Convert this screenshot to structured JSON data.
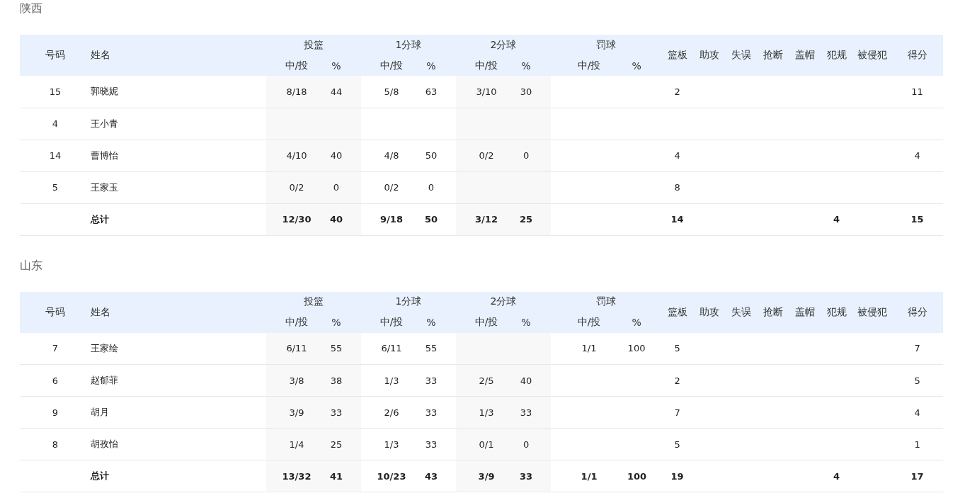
{
  "teams": [
    {
      "name": "陕西",
      "header": {
        "number": "号码",
        "name": "姓名",
        "groups": [
          {
            "label": "投篮",
            "made": "中/投",
            "pct": "%"
          },
          {
            "label": "1分球",
            "made": "中/投",
            "pct": "%"
          },
          {
            "label": "2分球",
            "made": "中/投",
            "pct": "%"
          },
          {
            "label": "罚球",
            "made": "中/投",
            "pct": "%"
          }
        ],
        "stats": [
          "篮板",
          "助攻",
          "失误",
          "抢断",
          "盖帽",
          "犯规",
          "被侵犯",
          "得分"
        ]
      },
      "rows": [
        {
          "kind": "player",
          "number": "15",
          "name": "郭晓妮",
          "field_goals": {
            "made": "8/18",
            "pct": "44"
          },
          "one_pointers": {
            "made": "5/8",
            "pct": "63"
          },
          "two_pointers": {
            "made": "3/10",
            "pct": "30"
          },
          "rebounds": "2",
          "points": "11"
        },
        {
          "kind": "player",
          "number": "4",
          "name": "王小青"
        },
        {
          "kind": "player",
          "number": "14",
          "name": "曹博怡",
          "field_goals": {
            "made": "4/10",
            "pct": "40"
          },
          "one_pointers": {
            "made": "4/8",
            "pct": "50"
          },
          "two_pointers": {
            "made": "0/2",
            "pct": "0"
          },
          "rebounds": "4",
          "points": "4"
        },
        {
          "kind": "player",
          "number": "5",
          "name": "王家玉",
          "field_goals": {
            "made": "0/2",
            "pct": "0"
          },
          "one_pointers": {
            "made": "0/2",
            "pct": "0"
          },
          "rebounds": "8"
        },
        {
          "kind": "total",
          "name": "总计",
          "field_goals": {
            "made": "12/30",
            "pct": "40"
          },
          "one_pointers": {
            "made": "9/18",
            "pct": "50"
          },
          "two_pointers": {
            "made": "3/12",
            "pct": "25"
          },
          "rebounds": "14",
          "fouls": "4",
          "points": "15"
        }
      ]
    },
    {
      "name": "山东",
      "header": {
        "number": "号码",
        "name": "姓名",
        "groups": [
          {
            "label": "投篮",
            "made": "中/投",
            "pct": "%"
          },
          {
            "label": "1分球",
            "made": "中/投",
            "pct": "%"
          },
          {
            "label": "2分球",
            "made": "中/投",
            "pct": "%"
          },
          {
            "label": "罚球",
            "made": "中/投",
            "pct": "%"
          }
        ],
        "stats": [
          "篮板",
          "助攻",
          "失误",
          "抢断",
          "盖帽",
          "犯规",
          "被侵犯",
          "得分"
        ]
      },
      "rows": [
        {
          "kind": "player",
          "number": "7",
          "name": "王家绘",
          "field_goals": {
            "made": "6/11",
            "pct": "55"
          },
          "one_pointers": {
            "made": "6/11",
            "pct": "55"
          },
          "free_throws": {
            "made": "1/1",
            "pct": "100"
          },
          "rebounds": "5",
          "points": "7"
        },
        {
          "kind": "player",
          "number": "6",
          "name": "赵郁菲",
          "field_goals": {
            "made": "3/8",
            "pct": "38"
          },
          "one_pointers": {
            "made": "1/3",
            "pct": "33"
          },
          "two_pointers": {
            "made": "2/5",
            "pct": "40"
          },
          "rebounds": "2",
          "points": "5"
        },
        {
          "kind": "player",
          "number": "9",
          "name": "胡月",
          "field_goals": {
            "made": "3/9",
            "pct": "33"
          },
          "one_pointers": {
            "made": "2/6",
            "pct": "33"
          },
          "two_pointers": {
            "made": "1/3",
            "pct": "33"
          },
          "rebounds": "7",
          "points": "4"
        },
        {
          "kind": "player",
          "number": "8",
          "name": "胡孜怡",
          "field_goals": {
            "made": "1/4",
            "pct": "25"
          },
          "one_pointers": {
            "made": "1/3",
            "pct": "33"
          },
          "two_pointers": {
            "made": "0/1",
            "pct": "0"
          },
          "rebounds": "5",
          "points": "1"
        },
        {
          "kind": "total",
          "name": "总计",
          "field_goals": {
            "made": "13/32",
            "pct": "41"
          },
          "one_pointers": {
            "made": "10/23",
            "pct": "43"
          },
          "two_pointers": {
            "made": "3/9",
            "pct": "33"
          },
          "free_throws": {
            "made": "1/1",
            "pct": "100"
          },
          "rebounds": "19",
          "fouls": "4",
          "points": "17"
        }
      ]
    }
  ]
}
